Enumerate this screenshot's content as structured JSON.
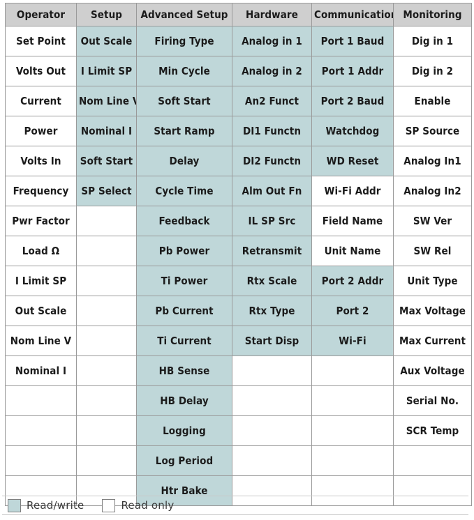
{
  "table": {
    "columns": [
      {
        "id": "operator",
        "header": "Operator"
      },
      {
        "id": "setup",
        "header": "Setup"
      },
      {
        "id": "advanced",
        "header": "Advanced Setup"
      },
      {
        "id": "hardware",
        "header": "Hardware"
      },
      {
        "id": "communication",
        "header": "Communication"
      },
      {
        "id": "monitoring",
        "header": "Monitoring"
      }
    ],
    "rows": [
      [
        {
          "label": "Set Point",
          "access": "ro"
        },
        {
          "label": "Out Scale",
          "access": "rw"
        },
        {
          "label": "Firing Type",
          "access": "rw"
        },
        {
          "label": "Analog in 1",
          "access": "rw"
        },
        {
          "label": "Port 1 Baud",
          "access": "rw"
        },
        {
          "label": "Dig in 1",
          "access": "ro"
        }
      ],
      [
        {
          "label": "Volts Out",
          "access": "ro"
        },
        {
          "label": "I Limit SP",
          "access": "rw"
        },
        {
          "label": "Min Cycle",
          "access": "rw"
        },
        {
          "label": "Analog in 2",
          "access": "rw"
        },
        {
          "label": "Port 1 Addr",
          "access": "rw"
        },
        {
          "label": "Dig in 2",
          "access": "ro"
        }
      ],
      [
        {
          "label": "Current",
          "access": "ro"
        },
        {
          "label": "Nom Line V",
          "access": "rw"
        },
        {
          "label": "Soft Start",
          "access": "rw"
        },
        {
          "label": "An2 Funct",
          "access": "rw"
        },
        {
          "label": "Port 2 Baud",
          "access": "rw"
        },
        {
          "label": "Enable",
          "access": "ro"
        }
      ],
      [
        {
          "label": "Power",
          "access": "ro"
        },
        {
          "label": "Nominal I",
          "access": "rw"
        },
        {
          "label": "Start Ramp",
          "access": "rw"
        },
        {
          "label": "DI1 Functn",
          "access": "rw"
        },
        {
          "label": "Watchdog",
          "access": "rw"
        },
        {
          "label": "SP Source",
          "access": "ro"
        }
      ],
      [
        {
          "label": "Volts In",
          "access": "ro"
        },
        {
          "label": "Soft Start",
          "access": "rw"
        },
        {
          "label": "Delay",
          "access": "rw"
        },
        {
          "label": "DI2 Functn",
          "access": "rw"
        },
        {
          "label": "WD Reset",
          "access": "rw"
        },
        {
          "label": "Analog In1",
          "access": "ro"
        }
      ],
      [
        {
          "label": "Frequency",
          "access": "ro"
        },
        {
          "label": "SP Select",
          "access": "rw"
        },
        {
          "label": "Cycle Time",
          "access": "rw"
        },
        {
          "label": "Alm Out Fn",
          "access": "rw"
        },
        {
          "label": "Wi-Fi Addr",
          "access": "ro"
        },
        {
          "label": "Analog In2",
          "access": "ro"
        }
      ],
      [
        {
          "label": "Pwr Factor",
          "access": "ro"
        },
        {
          "label": "",
          "access": "empty"
        },
        {
          "label": "Feedback",
          "access": "rw"
        },
        {
          "label": "IL SP Src",
          "access": "rw"
        },
        {
          "label": "Field Name",
          "access": "ro"
        },
        {
          "label": "SW Ver",
          "access": "ro"
        }
      ],
      [
        {
          "label": "Load Ω",
          "access": "ro"
        },
        {
          "label": "",
          "access": "empty"
        },
        {
          "label": "Pb Power",
          "access": "rw"
        },
        {
          "label": "Retransmit",
          "access": "rw"
        },
        {
          "label": "Unit Name",
          "access": "ro"
        },
        {
          "label": "SW Rel",
          "access": "ro"
        }
      ],
      [
        {
          "label": "I Limit SP",
          "access": "ro"
        },
        {
          "label": "",
          "access": "empty"
        },
        {
          "label": "Ti Power",
          "access": "rw"
        },
        {
          "label": "Rtx Scale",
          "access": "rw"
        },
        {
          "label": "Port 2 Addr",
          "access": "rw"
        },
        {
          "label": "Unit Type",
          "access": "ro"
        }
      ],
      [
        {
          "label": "Out Scale",
          "access": "ro"
        },
        {
          "label": "",
          "access": "empty"
        },
        {
          "label": "Pb Current",
          "access": "rw"
        },
        {
          "label": "Rtx Type",
          "access": "rw"
        },
        {
          "label": "Port 2",
          "access": "rw"
        },
        {
          "label": "Max Voltage",
          "access": "ro"
        }
      ],
      [
        {
          "label": "Nom Line V",
          "access": "ro"
        },
        {
          "label": "",
          "access": "empty"
        },
        {
          "label": "Ti Current",
          "access": "rw"
        },
        {
          "label": "Start Disp",
          "access": "rw"
        },
        {
          "label": "Wi-Fi",
          "access": "rw"
        },
        {
          "label": "Max Current",
          "access": "ro"
        }
      ],
      [
        {
          "label": "Nominal I",
          "access": "ro"
        },
        {
          "label": "",
          "access": "empty"
        },
        {
          "label": "HB Sense",
          "access": "rw"
        },
        {
          "label": "",
          "access": "empty"
        },
        {
          "label": "",
          "access": "empty"
        },
        {
          "label": "Aux Voltage",
          "access": "ro"
        }
      ],
      [
        {
          "label": "",
          "access": "empty"
        },
        {
          "label": "",
          "access": "empty"
        },
        {
          "label": "HB Delay",
          "access": "rw"
        },
        {
          "label": "",
          "access": "empty"
        },
        {
          "label": "",
          "access": "empty"
        },
        {
          "label": "Serial No.",
          "access": "ro"
        }
      ],
      [
        {
          "label": "",
          "access": "empty"
        },
        {
          "label": "",
          "access": "empty"
        },
        {
          "label": "Logging",
          "access": "rw"
        },
        {
          "label": "",
          "access": "empty"
        },
        {
          "label": "",
          "access": "empty"
        },
        {
          "label": "SCR Temp",
          "access": "ro"
        }
      ],
      [
        {
          "label": "",
          "access": "empty"
        },
        {
          "label": "",
          "access": "empty"
        },
        {
          "label": "Log Period",
          "access": "rw"
        },
        {
          "label": "",
          "access": "empty"
        },
        {
          "label": "",
          "access": "empty"
        },
        {
          "label": "",
          "access": "empty"
        }
      ],
      [
        {
          "label": "",
          "access": "empty"
        },
        {
          "label": "",
          "access": "empty"
        },
        {
          "label": "Htr Bake",
          "access": "rw"
        },
        {
          "label": "",
          "access": "empty"
        },
        {
          "label": "",
          "access": "empty"
        },
        {
          "label": "",
          "access": "empty"
        }
      ]
    ]
  },
  "legend": {
    "items": [
      {
        "label": "Read/write",
        "access": "rw"
      },
      {
        "label": "Read only",
        "access": "ro"
      }
    ]
  },
  "colors": {
    "read_write": "#bfd7d9",
    "read_only": "#ffffff",
    "header": "#cfcfcf",
    "border": "#9a9a9a",
    "text": "#1b1b1b"
  }
}
